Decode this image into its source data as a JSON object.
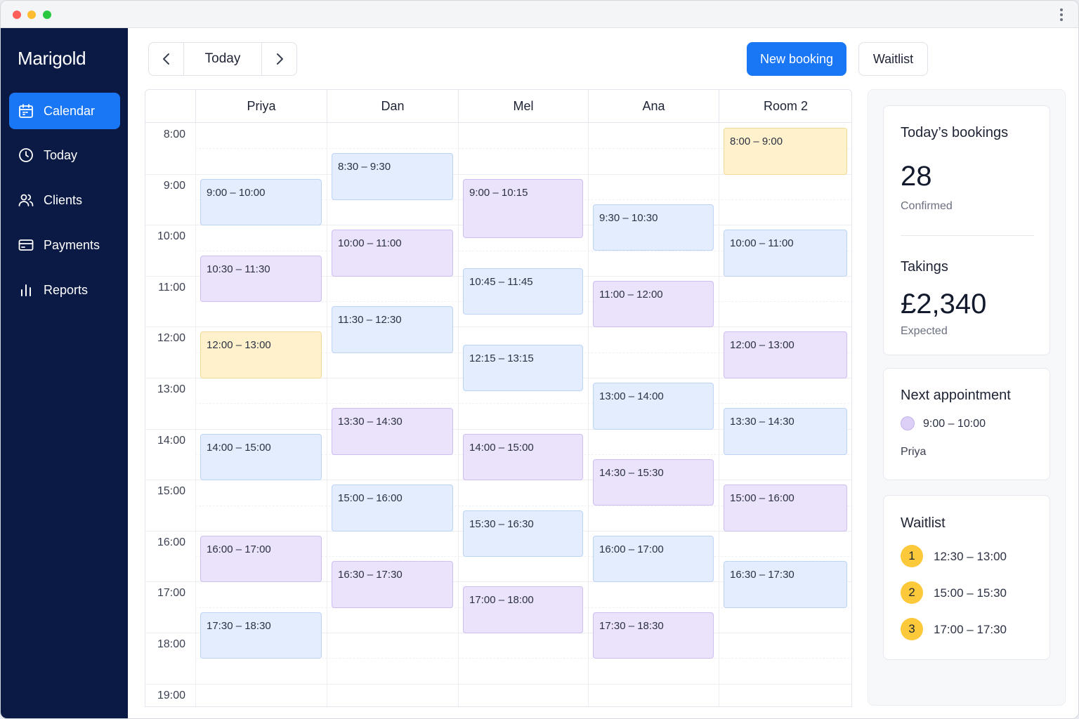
{
  "app": {
    "brand": "Marigold"
  },
  "sidebar": {
    "items": [
      {
        "label": "Calendar",
        "icon": "calendar-icon",
        "active": true
      },
      {
        "label": "Today",
        "icon": "clock-icon",
        "active": false
      },
      {
        "label": "Clients",
        "icon": "users-icon",
        "active": false
      },
      {
        "label": "Payments",
        "icon": "credit-card-icon",
        "active": false
      },
      {
        "label": "Reports",
        "icon": "bar-chart-icon",
        "active": false
      }
    ]
  },
  "toolbar": {
    "today_label": "Today",
    "new_booking_label": "New booking",
    "waitlist_label": "Waitlist"
  },
  "colors": {
    "accent": "#1976f5",
    "sidebar": "#0b1a44",
    "blue_event": "#e3edfe",
    "purple_event": "#ebe3fb",
    "yellow_event": "#fff1cc",
    "badge": "#fcc93a"
  },
  "calendar": {
    "columns": [
      "Priya",
      "Dan",
      "Mel",
      "Ana",
      "Room 2"
    ],
    "hours": [
      "8:00",
      "9:00",
      "10:00",
      "11:00",
      "12:00",
      "13:00",
      "14:00",
      "15:00",
      "16:00",
      "17:00",
      "18:00",
      "19:00"
    ],
    "events": [
      {
        "col": 0,
        "start": 9,
        "end": 10,
        "label": "9:00 – 10:00",
        "color": "blue"
      },
      {
        "col": 0,
        "start": 10.5,
        "end": 11.5,
        "label": "10:30 – 11:30",
        "color": "purple"
      },
      {
        "col": 0,
        "start": 12,
        "end": 13,
        "label": "12:00 – 13:00",
        "color": "yellow"
      },
      {
        "col": 0,
        "start": 14,
        "end": 15,
        "label": "14:00 – 15:00",
        "color": "blue"
      },
      {
        "col": 0,
        "start": 16,
        "end": 17,
        "label": "16:00 – 17:00",
        "color": "purple"
      },
      {
        "col": 0,
        "start": 17.5,
        "end": 18.5,
        "label": "17:30 – 18:30",
        "color": "blue"
      },
      {
        "col": 1,
        "start": 8.5,
        "end": 9.5,
        "label": "8:30 – 9:30",
        "color": "blue"
      },
      {
        "col": 1,
        "start": 10,
        "end": 11,
        "label": "10:00 – 11:00",
        "color": "purple"
      },
      {
        "col": 1,
        "start": 11.5,
        "end": 12.5,
        "label": "11:30 – 12:30",
        "color": "blue"
      },
      {
        "col": 1,
        "start": 13.5,
        "end": 14.5,
        "label": "13:30 – 14:30",
        "color": "purple"
      },
      {
        "col": 1,
        "start": 15,
        "end": 16,
        "label": "15:00 – 16:00",
        "color": "blue"
      },
      {
        "col": 1,
        "start": 16.5,
        "end": 17.5,
        "label": "16:30 – 17:30",
        "color": "purple"
      },
      {
        "col": 2,
        "start": 9,
        "end": 10.25,
        "label": "9:00 – 10:15",
        "color": "purple"
      },
      {
        "col": 2,
        "start": 10.75,
        "end": 11.75,
        "label": "10:45 – 11:45",
        "color": "blue"
      },
      {
        "col": 2,
        "start": 12.25,
        "end": 13.25,
        "label": "12:15 – 13:15",
        "color": "blue"
      },
      {
        "col": 2,
        "start": 14,
        "end": 15,
        "label": "14:00 – 15:00",
        "color": "purple"
      },
      {
        "col": 2,
        "start": 15.5,
        "end": 16.5,
        "label": "15:30 – 16:30",
        "color": "blue"
      },
      {
        "col": 2,
        "start": 17,
        "end": 18,
        "label": "17:00 – 18:00",
        "color": "purple"
      },
      {
        "col": 3,
        "start": 9.5,
        "end": 10.5,
        "label": "9:30 – 10:30",
        "color": "blue"
      },
      {
        "col": 3,
        "start": 11,
        "end": 12,
        "label": "11:00 – 12:00",
        "color": "purple"
      },
      {
        "col": 3,
        "start": 13,
        "end": 14,
        "label": "13:00 – 14:00",
        "color": "blue"
      },
      {
        "col": 3,
        "start": 14.5,
        "end": 15.5,
        "label": "14:30 – 15:30",
        "color": "purple"
      },
      {
        "col": 3,
        "start": 16,
        "end": 17,
        "label": "16:00 – 17:00",
        "color": "blue"
      },
      {
        "col": 3,
        "start": 17.5,
        "end": 18.5,
        "label": "17:30 – 18:30",
        "color": "purple"
      },
      {
        "col": 4,
        "start": 8,
        "end": 9,
        "label": "8:00 – 9:00",
        "color": "yellow"
      },
      {
        "col": 4,
        "start": 10,
        "end": 11,
        "label": "10:00 – 11:00",
        "color": "blue"
      },
      {
        "col": 4,
        "start": 12,
        "end": 13,
        "label": "12:00 – 13:00",
        "color": "purple"
      },
      {
        "col": 4,
        "start": 13.5,
        "end": 14.5,
        "label": "13:30 – 14:30",
        "color": "blue"
      },
      {
        "col": 4,
        "start": 15,
        "end": 16,
        "label": "15:00 – 16:00",
        "color": "purple"
      },
      {
        "col": 4,
        "start": 16.5,
        "end": 17.5,
        "label": "16:30 – 17:30",
        "color": "blue"
      }
    ]
  },
  "summary": {
    "title": "Today’s bookings",
    "count": "28",
    "count_label": "Confirmed",
    "takings_title": "Takings",
    "takings_value": "£2,340",
    "takings_label": "Expected"
  },
  "next_appointment": {
    "title": "Next appointment",
    "time": "9:00 – 10:00",
    "client": "Priya"
  },
  "waitlist": {
    "title": "Waitlist",
    "items": [
      {
        "number": "1",
        "time": "12:30 – 13:00"
      },
      {
        "number": "2",
        "time": "15:00 – 15:30"
      },
      {
        "number": "3",
        "time": "17:00 – 17:30"
      }
    ]
  }
}
